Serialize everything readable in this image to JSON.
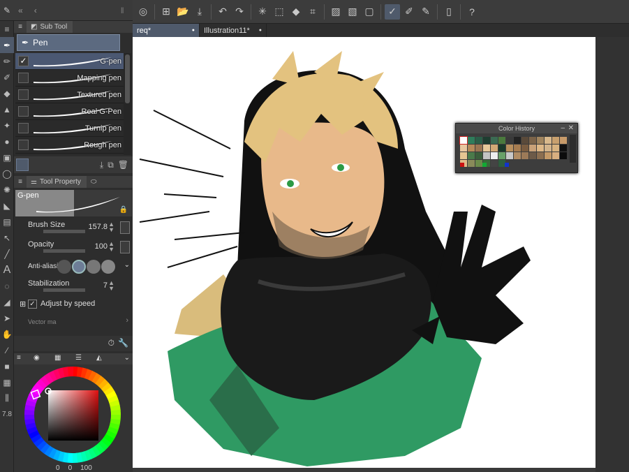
{
  "toolbar": {
    "icons": [
      "spiral-icon",
      "new-canvas-icon",
      "open-icon",
      "save-icon",
      "undo-icon",
      "redo-icon",
      "loading-icon",
      "transform-icon",
      "fill-icon",
      "crop-icon",
      "hatch-icon",
      "hatch2-icon",
      "frame-icon",
      "pen-active-icon",
      "brush-icon",
      "eraser-icon",
      "tablet-icon",
      "help-icon"
    ]
  },
  "subtool": {
    "tab_label": "Sub Tool",
    "group_label": "Pen",
    "brushes": [
      {
        "name": "G-pen",
        "selected": true
      },
      {
        "name": "Mapping pen",
        "selected": false
      },
      {
        "name": "Textured pen",
        "selected": false
      },
      {
        "name": "Real G-Pen",
        "selected": false
      },
      {
        "name": "Turnip pen",
        "selected": false
      },
      {
        "name": "Rough pen",
        "selected": false
      }
    ]
  },
  "tool_property": {
    "tab_label": "Tool Property",
    "tool_name": "G-pen",
    "brush_size_label": "Brush Size",
    "brush_size_value": "157.8",
    "opacity_label": "Opacity",
    "opacity_value": "100",
    "antialias_label": "Anti-aliasin",
    "stabilization_label": "Stabilization",
    "stabilization_value": "7",
    "adjust_speed_label": "Adjust by speed",
    "vector_label": "Vector ma"
  },
  "left_bottom": {
    "size_value": "7.8",
    "color_values": [
      "0",
      "0",
      "100"
    ]
  },
  "documents": {
    "tabs": [
      {
        "label": "req*",
        "active": true
      },
      {
        "label": "Illustration11*",
        "active": false
      }
    ]
  },
  "color_history": {
    "title": "Color History",
    "swatches": [
      "#ffffff",
      "#2e7d5b",
      "#2a5e48",
      "#1e3d30",
      "#3b6b53",
      "#4a7a3d",
      "#3a3a3a",
      "#222222",
      "#5a4a3a",
      "#7b6349",
      "#a0845e",
      "#d9b98c",
      "#c8a06e",
      "#c89b6a",
      "#e8c7a0",
      "#b58a5a",
      "#9a7552",
      "#e7c99a",
      "#d3a976",
      "#1a3a2a",
      "#b9905e",
      "#a67c50",
      "#7a5c40",
      "#c9a178",
      "#deb887",
      "#d2b48c",
      "#d8b380",
      "#111111",
      "#e6c592",
      "#4a7a4a",
      "#3b5e3b",
      "#c4c4c4",
      "#eeeeee",
      "#68a068",
      "#c9c9c9",
      "#b08c64",
      "#9c7a58",
      "#6d5a48",
      "#8b6e50",
      "#c59a68",
      "#d8af80",
      "#0c0c0c",
      "#e0ba88",
      "#8a8a5a",
      "#6a8a4a",
      "#3a6a3a",
      "#444444",
      "#2e5e3e"
    ],
    "markers": [
      "#cc1111",
      "#11aa33",
      "#1133cc"
    ]
  }
}
